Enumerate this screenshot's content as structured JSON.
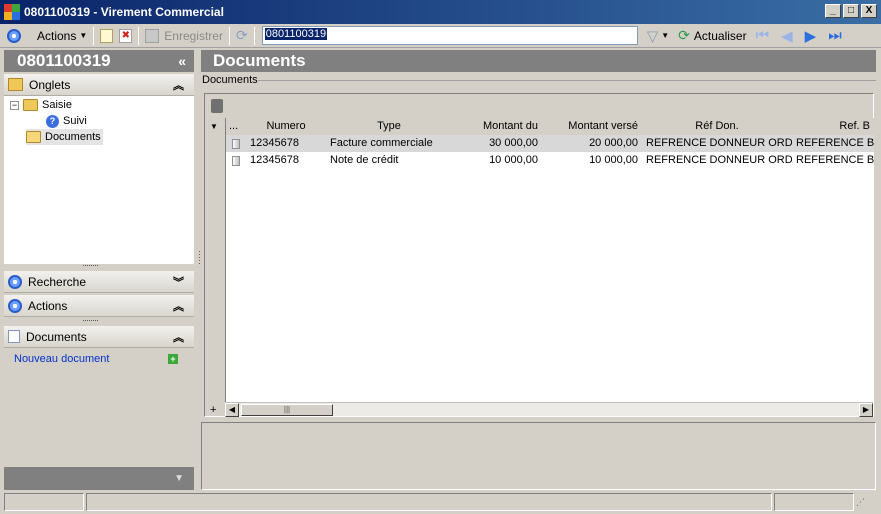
{
  "window": {
    "title": "0801100319 - Virement Commercial",
    "minimize": "_",
    "maximize": "□",
    "close": "X"
  },
  "toolbar": {
    "actions_label": "Actions",
    "save_label": "Enregistrer",
    "search_value": "0801100319",
    "refresh_label": "Actualiser"
  },
  "left": {
    "header_title": "0801100319",
    "collapse_glyph": "«",
    "tabs_section": "Onglets",
    "tree": {
      "root": "Saisie",
      "child": "Suivi",
      "documents": "Documents"
    },
    "search_section": "Recherche",
    "actions_section": "Actions",
    "documents_section": "Documents",
    "new_document_link": "Nouveau document"
  },
  "right": {
    "header_title": "Documents",
    "group_label": "Documents",
    "grid": {
      "columns": [
        "...",
        "Numero",
        "Type",
        "Montant du",
        "Montant versé",
        "Réf Don.",
        "Ref. B"
      ],
      "rows": [
        {
          "numero": "12345678",
          "type": "Facture commerciale",
          "montant_du": "30 000,00",
          "montant_verse": "20 000,00",
          "ref_don": "REFRENCE DONNEUR ORDRE",
          "ref_b": "REFERENCE BE"
        },
        {
          "numero": "12345678",
          "type": "Note de crédit",
          "montant_du": "10 000,00",
          "montant_verse": "10 000,00",
          "ref_don": "REFRENCE DONNEUR ORDRE",
          "ref_b": "REFERENCE BE"
        }
      ]
    }
  },
  "colors": {
    "title_bar": "#0a246a",
    "header_gray": "#808080",
    "link_blue": "#0033cc"
  }
}
